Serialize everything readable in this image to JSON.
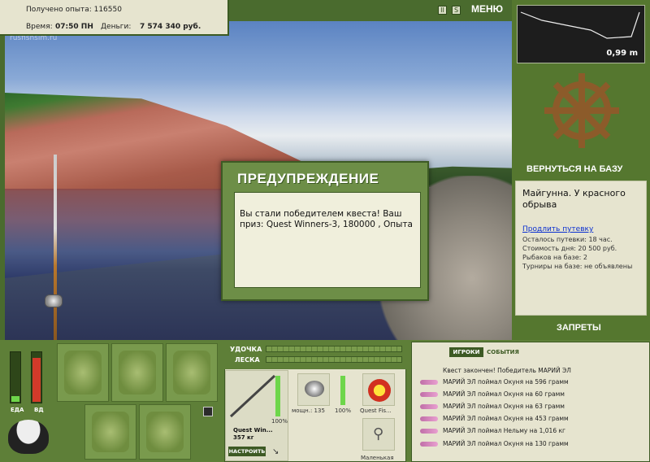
{
  "stats": {
    "experience": "Получено опыта: 116550",
    "time_label": "Время:",
    "time_value": "07:50 ПН",
    "money_label": "Деньги:",
    "money_value": "7 574 340 руб."
  },
  "scene": {
    "site_logo": "rusfishsim.ru"
  },
  "top_icons": {
    "pause": "II",
    "sound": "S"
  },
  "menu_label": "МЕНЮ",
  "depth": {
    "value": "0,99 m"
  },
  "right_panel": {
    "back_to_base": "ВЕРНУТЬСЯ НА БАЗУ",
    "location": "Майгунна. У красного обрыва",
    "extend_link": "Продлить путевку",
    "remaining": "Осталось путевки: 18 час.",
    "cost": "Стоимость дня: 20 500 руб.",
    "anglers": "Рыбаков на базе: 2",
    "tournaments": "Турниры на базе: не объявлены",
    "bans": "ЗАПРЕТЫ"
  },
  "dialog": {
    "title": "ПРЕДУПРЕЖДЕНИЕ",
    "message": "Вы стали победителем квеста! Ваш приз: Quest Winners-3, 180000 , Опыта"
  },
  "needs": {
    "food_label": "ЕДА",
    "water_label": "ВД",
    "food_level": 0.12,
    "water_level": 0.9
  },
  "gear": {
    "rod_label": "УДОЧКА",
    "line_label": "ЛЕСКА",
    "rod_name": "Quest Win...",
    "rod_weight": "357 кг",
    "rod_percent": "100%",
    "reel_info": "мощн.: 135",
    "reel_percent": "100%",
    "line_name": "Quest Fis...",
    "hook_name": "Маленькая",
    "setup_button": "НАСТРОИТЬ"
  },
  "events": {
    "tabs": [
      "ИГРОКИ",
      "СОБЫТИЯ"
    ],
    "active_tab": "ИГРОКИ",
    "lines": [
      "Квест закончен! Победитель МАРИЙ ЭЛ",
      "МАРИЙ ЭЛ поймал Окуня на 596 грамм",
      "МАРИЙ ЭЛ поймал Окуня на 60 грамм",
      "МАРИЙ ЭЛ поймал Окуня на 63 грамм",
      "МАРИЙ ЭЛ поймал Окуня на 453 грамм",
      "МАРИЙ ЭЛ поймал Нельму на 1,016 кг",
      "МАРИЙ ЭЛ поймал Окуня на 130 грамм"
    ]
  },
  "colors": {
    "panel_green": "#55772f",
    "cream": "#e6e4cf",
    "dialog_green": "#6d8e47",
    "link_blue": "#0a2fd1"
  }
}
